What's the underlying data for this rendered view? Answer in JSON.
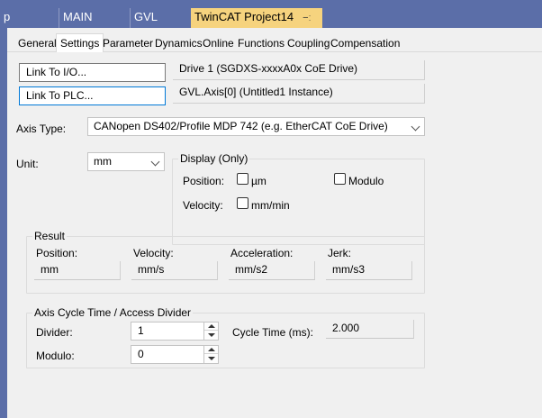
{
  "doc_tabs": [
    {
      "label": "p"
    },
    {
      "label": "MAIN"
    },
    {
      "label": "GVL"
    },
    {
      "label": "TwinCAT Project14"
    }
  ],
  "doc_tab_pin_icon": "pin-icon",
  "doc_tab_close_icon": "close-icon",
  "tabs": [
    "General",
    "Settings",
    "Parameter",
    "Dynamics",
    "Online",
    "Functions",
    "Coupling",
    "Compensation"
  ],
  "active_tab": "Settings",
  "link_io": {
    "button": "Link To I/O...",
    "value": "Drive 1 (SGDXS-xxxxA0x CoE Drive)"
  },
  "link_plc": {
    "button": "Link To PLC...",
    "value": "GVL.Axis[0] (Untitled1 Instance)"
  },
  "axis_type": {
    "label": "Axis Type:",
    "value": "CANopen DS402/Profile MDP 742 (e.g. EtherCAT CoE Drive)"
  },
  "unit": {
    "label": "Unit:",
    "value": "mm"
  },
  "display": {
    "title": "Display (Only)",
    "position_label": "Position:",
    "position_check": "µm",
    "modulo_check": "Modulo",
    "velocity_label": "Velocity:",
    "velocity_check": "mm/min"
  },
  "result": {
    "title": "Result",
    "columns": [
      {
        "label": "Position:",
        "value": "mm"
      },
      {
        "label": "Velocity:",
        "value": "mm/s"
      },
      {
        "label": "Acceleration:",
        "value": "mm/s2"
      },
      {
        "label": "Jerk:",
        "value": "mm/s3"
      }
    ]
  },
  "cycle": {
    "title": "Axis Cycle Time / Access Divider",
    "divider_label": "Divider:",
    "divider_value": "1",
    "cycle_time_label": "Cycle Time (ms):",
    "cycle_time_value": "2.000",
    "modulo_label": "Modulo:",
    "modulo_value": "0"
  },
  "colors": {
    "accent": "#5b6ea8",
    "active_doc_tab": "#f6d37e",
    "focus": "#0078d7"
  }
}
